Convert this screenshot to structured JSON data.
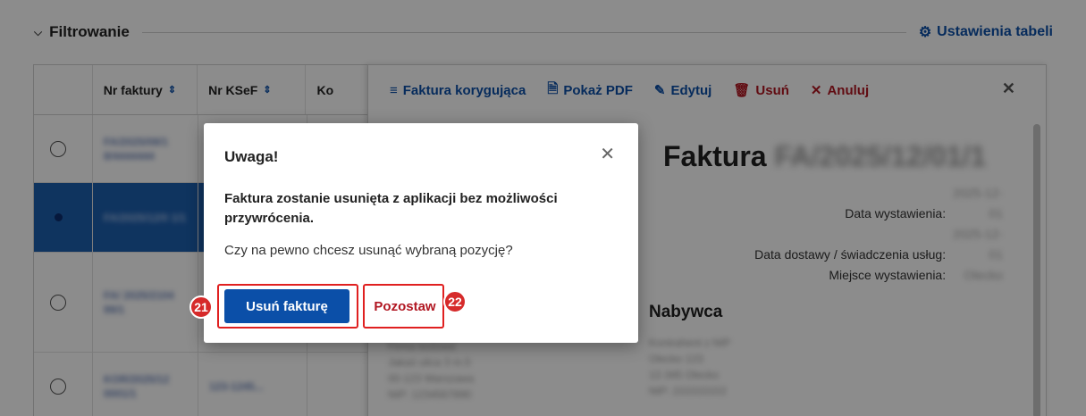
{
  "filter": {
    "toggle_label": "Filtrowanie",
    "settings_label": "Ustawienia tabeli"
  },
  "table": {
    "columns": [
      "Nr faktury",
      "Nr KSeF",
      "Ko"
    ],
    "sort_icon": "⇕",
    "rows": [
      {
        "invoice": "FA/2025/08/1 8/4444444",
        "ksef": "",
        "selected": false
      },
      {
        "invoice": "FA/2025/12/0 1/1",
        "ksef": "",
        "selected": true
      },
      {
        "invoice": "FA/ 2025/2104 99/1",
        "ksef": "",
        "selected": false
      },
      {
        "invoice": "KOR/2025/12 0001/1",
        "ksef": "123-1245...",
        "selected": false
      }
    ]
  },
  "panel": {
    "toolbar": {
      "corrective": "Faktura korygująca",
      "show_pdf": "Pokaż PDF",
      "edit": "Edytuj",
      "delete": "Usuń",
      "cancel": "Anuluj"
    },
    "title_prefix": "Faktura",
    "title_number": "FA/2025/12/01/1",
    "meta": {
      "issue_date_label": "Data wystawienia:",
      "delivery_date_label": "Data dostawy / świadczenia usług:",
      "place_label": "Miejsce wystawienia:",
      "issue_date": "2025-12-01",
      "delivery_date": "2025-12-01",
      "place": "Olecko"
    },
    "buyer_label": "Nabywca",
    "buyer_lines": [
      "Kontrahent z NIP",
      "Olecko 123",
      "12-345 Olecko",
      "NIP: 222222222"
    ],
    "seller_lines": [
      "Firma testowa",
      "Jakaś ulica 3 m.5",
      "00-123 Warszawa",
      "NIP: 1234567890"
    ]
  },
  "dialog": {
    "title": "Uwaga!",
    "message_strong": "Faktura zostanie usunięta z aplikacji bez możliwości przywrócenia.",
    "question": "Czy na pewno chcesz usunąć wybraną pozycję?",
    "confirm_label": "Usuń fakturę",
    "keep_label": "Pozostaw"
  },
  "annotations": {
    "confirm_badge": "21",
    "keep_badge": "22",
    "highlight_color": "#e02020"
  },
  "colors": {
    "primary": "#0b4fa8",
    "danger": "#b11722",
    "selected_row": "#1d5fae"
  }
}
